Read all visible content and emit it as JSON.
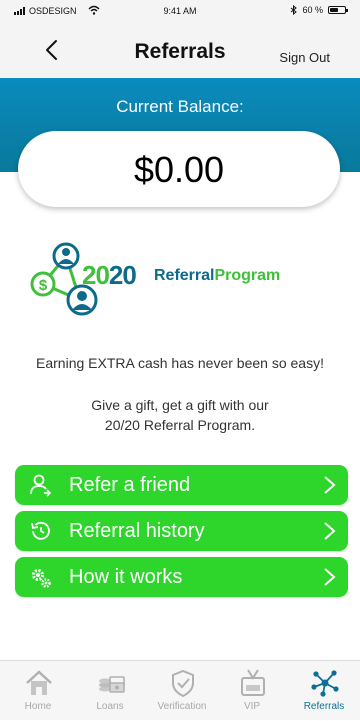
{
  "status_bar": {
    "carrier": "OSDESIGN",
    "time": "9:41 AM",
    "battery": "60 %",
    "battery_level": 0.6
  },
  "header": {
    "title": "Referrals",
    "sign_out": "Sign Out"
  },
  "balance": {
    "label": "Current Balance:",
    "amount": "$0.00"
  },
  "logo": {
    "part1": "20",
    "part2": "20",
    "word1": "Referral",
    "word2": "Program"
  },
  "copy": {
    "line1": "Earning EXTRA cash has never been so easy!",
    "line2": "Give a gift, get a gift with our",
    "line3": "20/20 Referral Program."
  },
  "actions": [
    {
      "label": "Refer a friend",
      "icon": "add-user-icon"
    },
    {
      "label": "Referral history",
      "icon": "history-icon"
    },
    {
      "label": "How it works",
      "icon": "gears-icon"
    }
  ],
  "tabs": [
    {
      "label": "Home",
      "icon": "home-icon"
    },
    {
      "label": "Loans",
      "icon": "money-icon"
    },
    {
      "label": "Verification",
      "icon": "shield-check-icon"
    },
    {
      "label": "VIP",
      "icon": "vip-badge-icon"
    },
    {
      "label": "Referrals",
      "icon": "network-icon",
      "active": true
    }
  ],
  "colors": {
    "banner": "#0a84b4",
    "button_green": "#2ed52b",
    "active_tab": "#0d6f95",
    "logo_green": "#3fbf3a",
    "logo_blue": "#0d6a8a"
  }
}
